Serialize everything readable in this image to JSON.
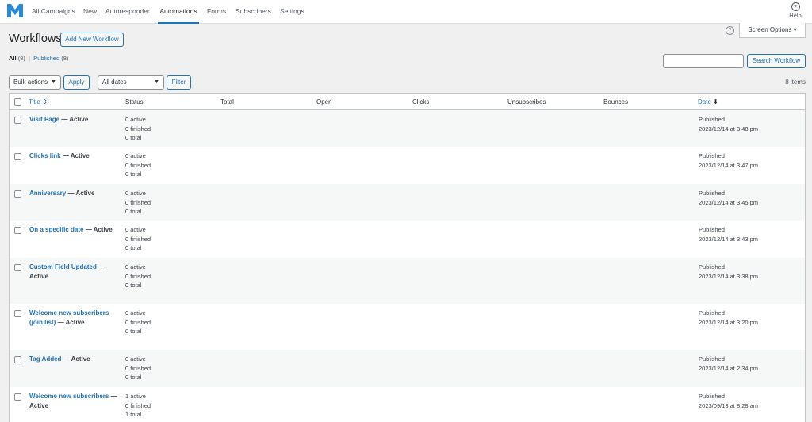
{
  "nav": {
    "items": [
      "All Campaigns",
      "New",
      "Autoresponder",
      "Automations",
      "Forms",
      "Subscribers",
      "Settings"
    ],
    "active": "Automations",
    "help": "Help"
  },
  "screen_options": "Screen Options ▾",
  "title": "Workflows",
  "add_new": "Add New Workflow",
  "views": {
    "all": "All",
    "all_count": "(8)",
    "published": "Published",
    "published_count": "(8)"
  },
  "search_button": "Search Workflow",
  "bulk": {
    "selected": "Bulk actions",
    "apply": "Apply"
  },
  "dates": {
    "selected": "All dates",
    "filter": "Filter"
  },
  "items_count": "8 items",
  "columns": {
    "title": "Title",
    "status": "Status",
    "total": "Total",
    "open": "Open",
    "clicks": "Clicks",
    "unsubscribes": "Unsubscribes",
    "bounces": "Bounces",
    "date": "Date"
  },
  "rows": [
    {
      "name": "Visit Page",
      "state": "— Active",
      "active": "0 active",
      "finished": "0 finished",
      "total": "0 total",
      "pub": "Published",
      "date": "2023/12/14 at 3:48 pm"
    },
    {
      "name": "Clicks link",
      "state": "— Active",
      "active": "0 active",
      "finished": "0 finished",
      "total": "0 total",
      "pub": "Published",
      "date": "2023/12/14 at 3:47 pm"
    },
    {
      "name": "Anniversary",
      "state": "— Active",
      "active": "0 active",
      "finished": "0 finished",
      "total": "0 total",
      "pub": "Published",
      "date": "2023/12/14 at 3:45 pm"
    },
    {
      "name": "On a specific date",
      "state": "— Active",
      "active": "0 active",
      "finished": "0 finished",
      "total": "0 total",
      "pub": "Published",
      "date": "2023/12/14 at 3:43 pm"
    },
    {
      "name": "Custom Field Updated",
      "state": "— Active",
      "active": "0 active",
      "finished": "0 finished",
      "total": "0 total",
      "pub": "Published",
      "date": "2023/12/14 at 3:38 pm"
    },
    {
      "name": "Welcome new subscribers (join list)",
      "state": "— Active",
      "active": "0 active",
      "finished": "0 finished",
      "total": "0 total",
      "pub": "Published",
      "date": "2023/12/14 at 3:20 pm"
    },
    {
      "name": "Tag Added",
      "state": "— Active",
      "active": "0 active",
      "finished": "0 finished",
      "total": "0 total",
      "pub": "Published",
      "date": "2023/12/14 at 2:34 pm"
    },
    {
      "name": "Welcome new subscribers",
      "state": "— Active",
      "active": "1 active",
      "finished": "0 finished",
      "total": "1 total",
      "pub": "Published",
      "date": "2023/09/13 at 8:28 am"
    }
  ]
}
